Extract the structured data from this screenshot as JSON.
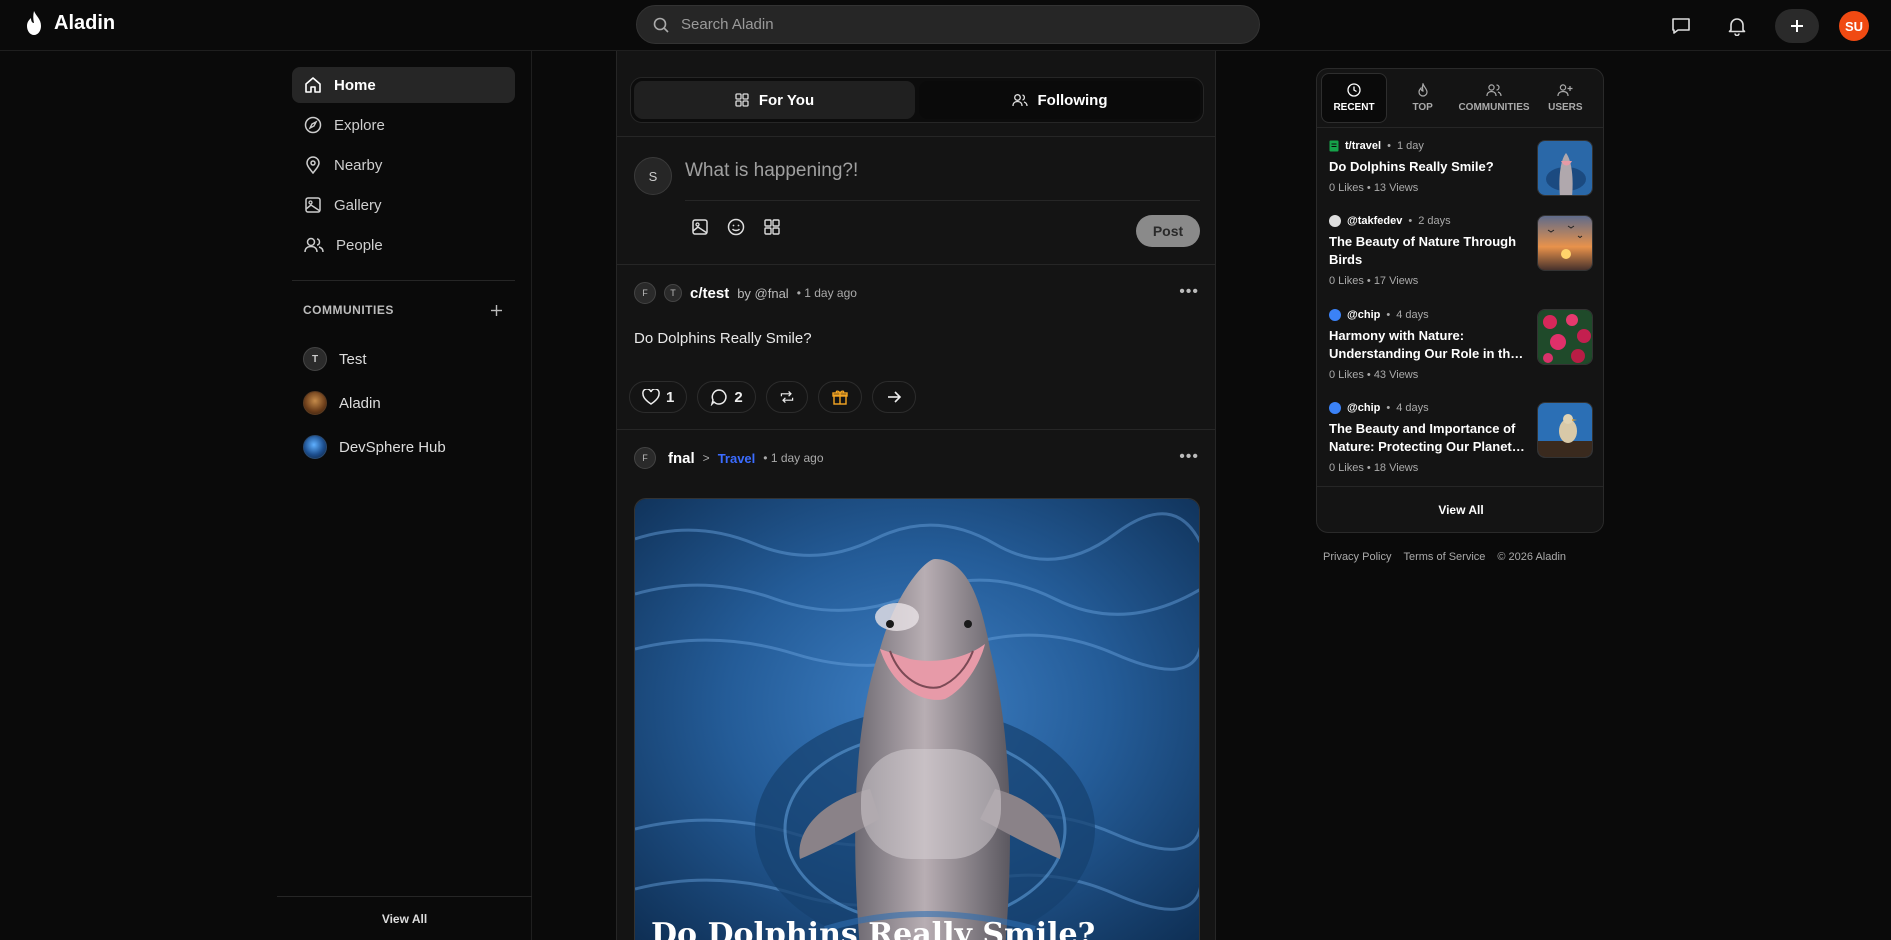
{
  "app": {
    "name": "Aladin"
  },
  "search": {
    "placeholder": "Search Aladin"
  },
  "user": {
    "initials": "SU",
    "avatar_color": "#f04a12"
  },
  "sidebar": {
    "nav": [
      {
        "label": "Home",
        "icon": "home-icon",
        "active": true
      },
      {
        "label": "Explore",
        "icon": "compass-icon"
      },
      {
        "label": "Nearby",
        "icon": "map-pin-icon"
      },
      {
        "label": "Gallery",
        "icon": "image-icon"
      },
      {
        "label": "People",
        "icon": "users-icon"
      }
    ],
    "communities_heading": "COMMUNITIES",
    "communities": [
      {
        "name": "Test",
        "initial": "T"
      },
      {
        "name": "Aladin",
        "initial": ""
      },
      {
        "name": "DevSphere Hub",
        "initial": ""
      }
    ],
    "view_all": "View All"
  },
  "feed": {
    "tabs": [
      {
        "label": "For You",
        "icon": "grid-icon",
        "active": true
      },
      {
        "label": "Following",
        "icon": "users-icon",
        "active": false
      }
    ],
    "composer": {
      "avatar_initial": "S",
      "placeholder": "What is happening?!",
      "post_label": "Post"
    },
    "post1": {
      "avatar_initial": "F",
      "community_initial": "T",
      "community": "c/test",
      "by": "by @fnal",
      "time": "• 1 day ago",
      "text": "Do Dolphins Really Smile?",
      "likes": "1",
      "comments": "2"
    },
    "post2": {
      "avatar_initial": "F",
      "author": "fnal",
      "separator": ">",
      "community": "Travel",
      "time": "• 1 day ago",
      "image_title": "Do Dolphins Really Smile?"
    }
  },
  "right_panel": {
    "tabs": [
      {
        "label": "RECENT",
        "icon": "clock-icon",
        "active": true
      },
      {
        "label": "TOP",
        "icon": "flame-icon"
      },
      {
        "label": "COMMUNITIES",
        "icon": "users-icon"
      },
      {
        "label": "USERS",
        "icon": "user-plus-icon"
      }
    ],
    "items": [
      {
        "source": "t/travel",
        "time": "1 day",
        "title": "Do Dolphins Really Smile?",
        "stats": "0 Likes • 13 Views",
        "icon_color": "#22c55e"
      },
      {
        "source": "@takfedev",
        "time": "2 days",
        "title": "The Beauty of Nature Through Birds",
        "stats": "0 Likes • 17 Views",
        "icon_color": "#dddddd"
      },
      {
        "source": "@chip",
        "time": "4 days",
        "title": "Harmony with Nature: Understanding Our Role in the Ecosystem",
        "stats": "0 Likes • 43 Views",
        "icon_color": "#3b82f6"
      },
      {
        "source": "@chip",
        "time": "4 days",
        "title": "The Beauty and Importance of Nature: Protecting Our Planet for Future Generations",
        "stats": "0 Likes • 18 Views",
        "icon_color": "#3b82f6"
      }
    ],
    "view_all": "View All"
  },
  "footer": {
    "privacy": "Privacy Policy",
    "terms": "Terms of Service",
    "copyright": "© 2026 Aladin"
  }
}
